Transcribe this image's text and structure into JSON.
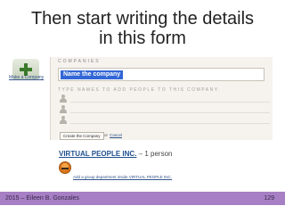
{
  "slide": {
    "title_line1": "Then start writing the details",
    "title_line2": "in this form"
  },
  "sidebar": {
    "add_company_label": "Make a Company"
  },
  "form": {
    "header": "COMPANIES",
    "name_value": "Name the company",
    "people_caption": "TYPE NAMES TO ADD PEOPLE TO THIS COMPANY.",
    "create_label": "Create the Company",
    "or_text": "or",
    "cancel_label": "Cancel"
  },
  "company": {
    "name": "VIRTUAL PEOPLE INC.",
    "separator": "–",
    "count": "1 person",
    "add_dept_label": "Add a group department inside VIRTUAL PEOPLE INC."
  },
  "footer": {
    "left": "2015 – Eileen B. Gonzales",
    "page_number": "129"
  },
  "colors": {
    "footer_bg": "#a67fc4",
    "selection": "#3367d6",
    "link": "#33558a"
  }
}
